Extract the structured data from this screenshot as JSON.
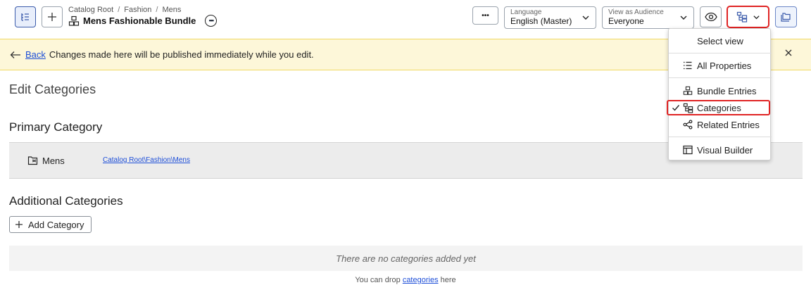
{
  "header": {
    "breadcrumb": [
      "Catalog Root",
      "Fashion",
      "Mens"
    ],
    "title": "Mens Fashionable Bundle",
    "more_label": "•••",
    "language": {
      "label": "Language",
      "value": "English (Master)"
    },
    "audience": {
      "label": "View as Audience",
      "value": "Everyone"
    }
  },
  "banner": {
    "back_label": "Back",
    "message": "Changes made here will be published immediately while you edit."
  },
  "content": {
    "heading": "Edit Categories",
    "primary_heading": "Primary Category",
    "primary": {
      "name": "Mens",
      "path": "Catalog Root\\Fashion\\Mens"
    },
    "additional_heading": "Additional Categories",
    "add_button": "Add Category",
    "empty_message": "There are no categories added yet",
    "drop_hint_pre": "You can drop",
    "drop_hint_link": "categories",
    "drop_hint_post": "here"
  },
  "view_menu": {
    "heading": "Select view",
    "items": [
      {
        "label": "All Properties",
        "icon": "list-icon"
      },
      {
        "label": "Bundle Entries",
        "icon": "bundle-icon"
      },
      {
        "label": "Categories",
        "icon": "category-tree-icon",
        "selected": true
      },
      {
        "label": "Related Entries",
        "icon": "share-icon"
      },
      {
        "label": "Visual Builder",
        "icon": "layout-icon"
      }
    ]
  },
  "colors": {
    "accent_blue": "#1d4ed8",
    "highlight_red": "#e02424",
    "banner_bg": "#fdf7d9"
  }
}
